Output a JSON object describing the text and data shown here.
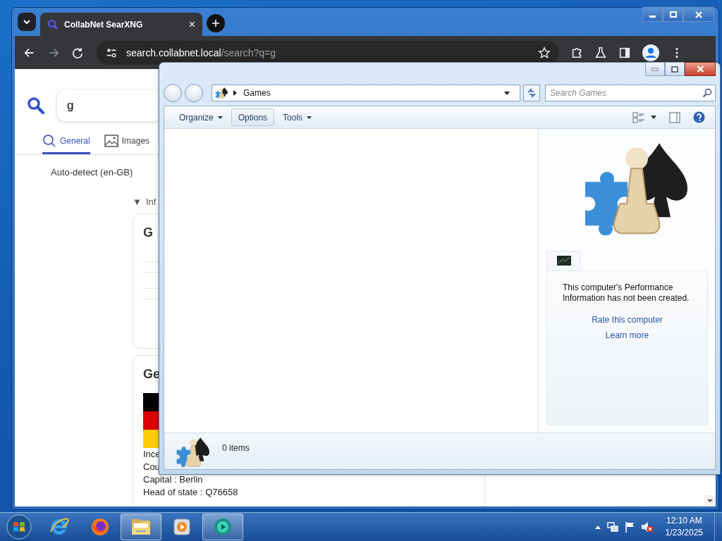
{
  "browser": {
    "tab": {
      "title": "CollabNet SearXNG",
      "close": "×"
    },
    "address": {
      "host": "search.collabnet.local",
      "path": "/search?q=g"
    },
    "search": {
      "value": "g"
    },
    "categories": [
      {
        "label": "General",
        "selected": true
      },
      {
        "label": "Images",
        "selected": false
      }
    ],
    "language": "Auto-detect (en-GB)",
    "infobox_toggle": {
      "arrow": "▼",
      "label": "Inf"
    },
    "cards": [
      {
        "title": "G"
      },
      {
        "title": "Ge",
        "facts": [
          "Ince",
          "Cou",
          "Capital : Berlin",
          "Head of state : Q76658"
        ]
      }
    ]
  },
  "explorer": {
    "breadcrumb": "Games",
    "search": {
      "placeholder": "Search Games"
    },
    "toolbar": [
      {
        "label": "Organize",
        "kind": "menu",
        "highlighted": false
      },
      {
        "label": "Options",
        "kind": "button",
        "highlighted": true
      },
      {
        "label": "Tools",
        "kind": "menu",
        "highlighted": false
      }
    ],
    "performance": {
      "message": "This computer's Performance Information has not been created.",
      "links": [
        "Rate this computer",
        "Learn more"
      ]
    },
    "status": "0 items"
  },
  "taskbar": {
    "apps": [
      {
        "kind": "ie",
        "active": false
      },
      {
        "kind": "firefox",
        "active": false
      },
      {
        "kind": "explorer",
        "active": true
      },
      {
        "kind": "media",
        "active": false
      },
      {
        "kind": "app",
        "active": true
      }
    ],
    "clock": {
      "time": "12:10 AM",
      "date": "1/23/2025"
    }
  }
}
